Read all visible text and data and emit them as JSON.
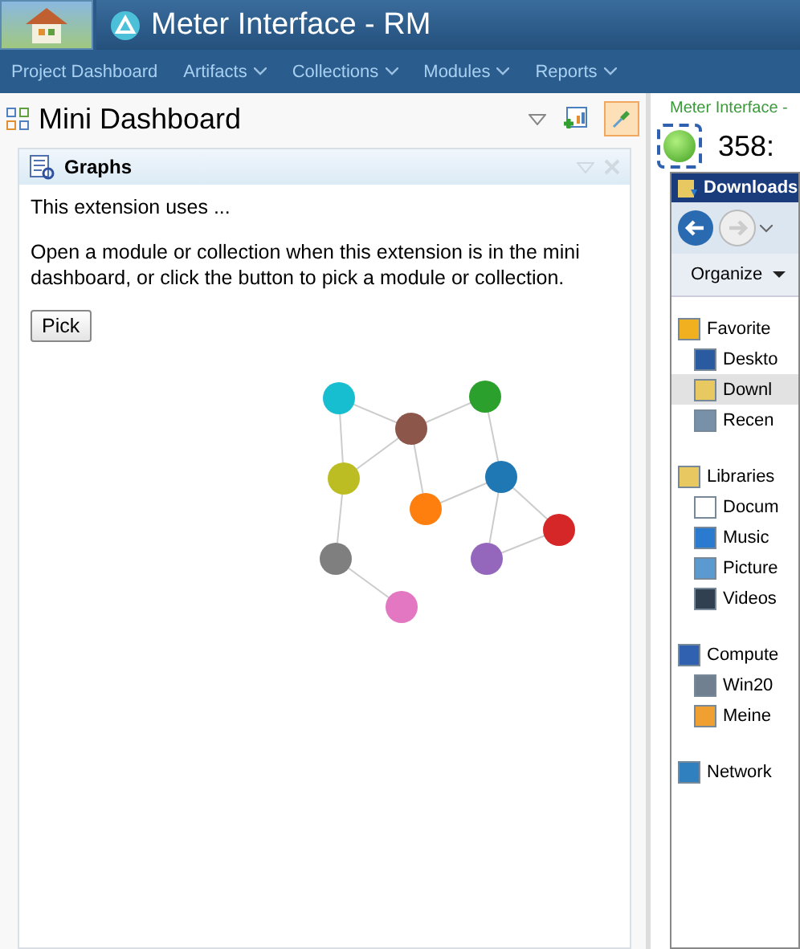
{
  "app": {
    "title": "Meter Interface - RM"
  },
  "nav": [
    {
      "label": "Project Dashboard",
      "dropdown": false
    },
    {
      "label": "Artifacts",
      "dropdown": true
    },
    {
      "label": "Collections",
      "dropdown": true
    },
    {
      "label": "Modules",
      "dropdown": true
    },
    {
      "label": "Reports",
      "dropdown": true
    }
  ],
  "dashboard": {
    "title": "Mini Dashboard",
    "pinned": true
  },
  "widget": {
    "title": "Graphs",
    "intro": "This extension uses ...",
    "message": "Open a module or collection when this extension is in the mini dashboard, or click the button to pick a module or collection.",
    "button": "Pick",
    "nodes": [
      {
        "color": "#17becf"
      },
      {
        "color": "#8c564b"
      },
      {
        "color": "#2ca02c"
      },
      {
        "color": "#bcbd22"
      },
      {
        "color": "#1f77b4"
      },
      {
        "color": "#ff7f0e"
      },
      {
        "color": "#d62728"
      },
      {
        "color": "#7f7f7f"
      },
      {
        "color": "#9467bd"
      },
      {
        "color": "#e377c2"
      }
    ]
  },
  "side": {
    "link": "Meter Interface -",
    "count": "358:"
  },
  "explorer": {
    "title": "Downloads",
    "organize": "Organize",
    "tree": [
      {
        "label": "Favorite",
        "children": [
          {
            "label": "Deskto",
            "selected": false
          },
          {
            "label": "Downl",
            "selected": true
          },
          {
            "label": "Recen",
            "selected": false
          }
        ]
      },
      {
        "label": "Libraries",
        "children": [
          {
            "label": "Docum",
            "selected": false
          },
          {
            "label": "Music",
            "selected": false
          },
          {
            "label": "Picture",
            "selected": false
          },
          {
            "label": "Videos",
            "selected": false
          }
        ]
      },
      {
        "label": "Compute",
        "children": [
          {
            "label": "Win20",
            "selected": false
          },
          {
            "label": "Meine",
            "selected": false
          }
        ]
      },
      {
        "label": "Network"
      }
    ]
  }
}
